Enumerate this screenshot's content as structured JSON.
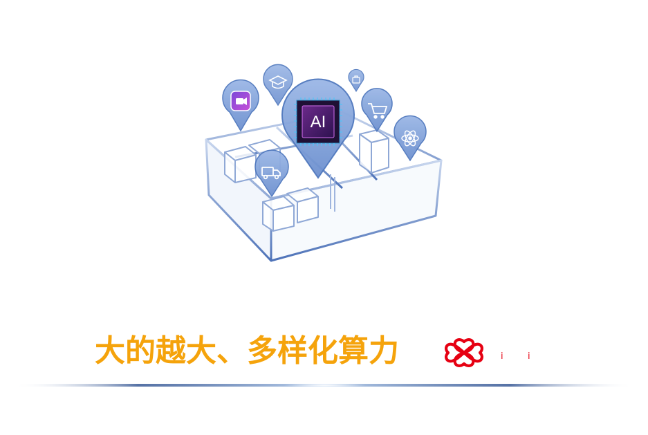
{
  "slide": {
    "title": "大的越大、多样化算力",
    "colors": {
      "title": "#f5a30b",
      "logo": "#e60012",
      "outline": "#5a7fc0",
      "pin_fill": "#7d9fd6",
      "pin_stroke": "#3f6ab4",
      "chip": "#4b1a6b"
    }
  },
  "illustration": {
    "chip_label": "AI",
    "icons": [
      "video-icon",
      "graduation-cap-icon",
      "briefcase-icon",
      "shopping-cart-icon",
      "atom-icon",
      "delivery-truck-icon"
    ]
  },
  "logo": {
    "name": "china-unicom-knot-logo",
    "chars": [
      "i",
      "i"
    ]
  }
}
